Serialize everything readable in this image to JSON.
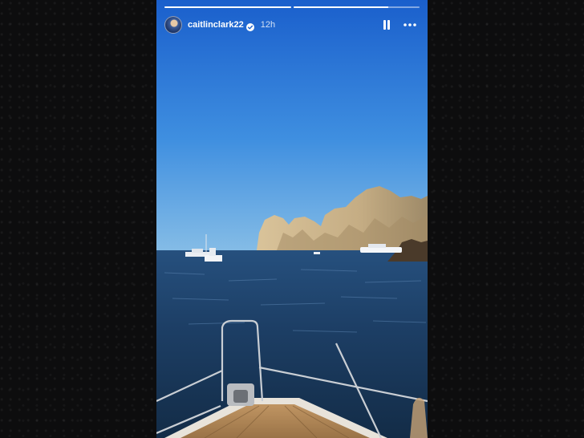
{
  "story": {
    "username": "caitlinclark22",
    "verified": true,
    "timestamp": "12h",
    "progress_segments": [
      1.0,
      0.75
    ],
    "icons": {
      "avatar": "profile-avatar",
      "verified": "verified-badge-icon",
      "pause": "pause-icon",
      "more": "more-options-icon"
    }
  },
  "colors": {
    "sky_top": "#1d64cf",
    "sky_bottom": "#7fb7e6",
    "sea": "#1b3a5e",
    "rock": "#c9b48e",
    "backdrop": "#0d0d0e"
  }
}
